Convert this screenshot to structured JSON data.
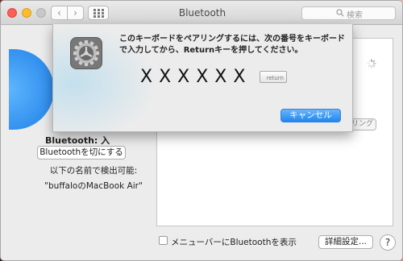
{
  "window": {
    "title": "Bluetooth"
  },
  "search": {
    "placeholder": "検索"
  },
  "bluetooth": {
    "status": "Bluetooth: 入",
    "toggle_label": "Bluetoothを切にする",
    "discoverable_label": "以下の名前で検出可能:",
    "device_name": "\"buffaloのMacBook Air\""
  },
  "device_list": {
    "pair_button_partial": "リング"
  },
  "bottom": {
    "show_in_menubar_label": "メニューバーにBluetoothを表示",
    "show_in_menubar_checked": false,
    "advanced_label": "詳細設定...",
    "help_label": "?"
  },
  "pairing_sheet": {
    "message": "このキーボードをペアリングするには、次の番号をキーボードで入力してから、Returnキーを押してください。",
    "passkey": "XXXXXX",
    "return_key_label": "return",
    "cancel_label": "キャンセル"
  },
  "colors": {
    "accent": "#1e86f0",
    "bluetooth_blue": "#1e7fe6"
  }
}
